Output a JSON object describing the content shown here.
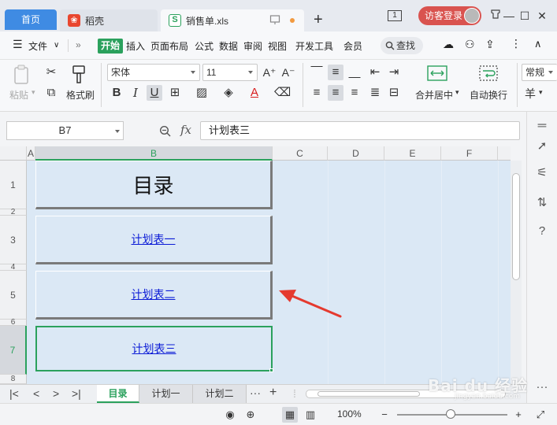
{
  "titlebar": {
    "home_tab": "首页",
    "tabs": [
      {
        "label": "稻壳",
        "icon": "wps-icon"
      },
      {
        "label": "销售单.xls",
        "icon": "xls-icon"
      }
    ],
    "window_number": "1",
    "login_label": "访客登录"
  },
  "menu": {
    "file": "文件",
    "items": [
      "开始",
      "插入",
      "页面布局",
      "公式",
      "数据",
      "审阅",
      "视图",
      "开发工具",
      "会员"
    ],
    "search": "查找"
  },
  "ribbon": {
    "paste": "粘贴",
    "format_painter": "格式刷",
    "font_name": "宋体",
    "font_size": "11",
    "merge_center": "合并居中",
    "wrap_text": "自动换行",
    "number_format": "常规",
    "currency_symbol": "羊"
  },
  "formula_bar": {
    "cell_ref": "B7",
    "fx": "fx",
    "content": "计划表三"
  },
  "grid": {
    "columns": [
      "A",
      "B",
      "C",
      "D",
      "E",
      "F"
    ],
    "rows": [
      "1",
      "2",
      "3",
      "4",
      "5",
      "6",
      "7",
      "8"
    ],
    "active_column": "B",
    "active_row": "7",
    "cells": {
      "b1": "目录",
      "b3": "计划表一",
      "b5": "计划表二",
      "b7": "计划表三"
    }
  },
  "sheets": {
    "tabs": [
      "目录",
      "计划一",
      "计划二"
    ],
    "active": "目录",
    "more": "···",
    "add": "+"
  },
  "status": {
    "zoom": "100%",
    "zoom_level_percent": 100
  },
  "watermark": {
    "brand": "Bai du 经验",
    "url": "jingyan.baidu.com"
  },
  "colors": {
    "accent_green": "#2ba15d",
    "home_blue": "#3f8be3",
    "login_red": "#d9534f",
    "cell_fill": "#dbe8f5",
    "link_blue": "#0b1bd6",
    "arrow_red": "#e53a2f"
  }
}
